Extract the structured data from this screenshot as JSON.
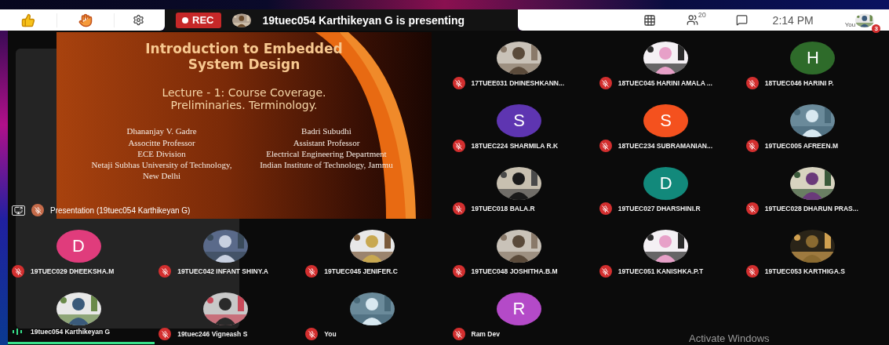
{
  "toolbar": {
    "reactions": [
      {
        "kind": "thumbs"
      },
      {
        "kind": "hand"
      }
    ],
    "record_button": "REC",
    "presenter_text": "19tuec054 Karthikeyan G is presenting",
    "participant_count": "20",
    "time": "2:14 PM",
    "self_label": "You",
    "notification_badge": "3"
  },
  "presentation": {
    "slide": {
      "title": "Introduction to Embedded System Design",
      "subtitle": "Lecture - 1: Course Coverage. Preliminaries. Terminology.",
      "authors": [
        [
          "Dhananjay V. Gadre",
          "Associtte Professor",
          "ECE Division",
          "Netaji Subhas University of Technology, New Delhi"
        ],
        [
          "Badri Subudhi",
          "Assistant Professor",
          "Electrical Engineering Department",
          "Indian Institute of Technology, Jammu"
        ]
      ]
    },
    "label": "Presentation (19tuec054 Karthikeyan G)"
  },
  "participants": [
    {
      "name": "17TUEE031 DHINESHKANN...",
      "muted": true
    },
    {
      "name": "18TUEC045 HARINI AMALA ...",
      "muted": true
    },
    {
      "name": "18TUEC046 HARINI P.",
      "avatar": {
        "kind": "initial",
        "letter": "H",
        "color": "#2e6b2a"
      },
      "muted": true
    },
    {
      "name": "18TUEC224 SHARMILA R.K",
      "avatar": {
        "kind": "initial",
        "letter": "S",
        "color": "#5e35b1"
      },
      "muted": true
    },
    {
      "name": "18TUEC234 SUBRAMANIAN...",
      "avatar": {
        "kind": "initial",
        "letter": "S",
        "color": "#f4511e"
      },
      "muted": true
    },
    {
      "name": "19TUEC005 AFREEN.M",
      "muted": true
    },
    {
      "name": "19TUEC018 BALA.R",
      "muted": true
    },
    {
      "name": "19TUEC027 DHARSHINI.R",
      "avatar": {
        "kind": "initial",
        "letter": "D",
        "color": "#12897b"
      },
      "muted": true
    },
    {
      "name": "19TUEC028 DHARUN PRAS...",
      "muted": true
    },
    {
      "name": "19TUEC029 DHEEKSHA.M",
      "avatar": {
        "kind": "initial",
        "letter": "D",
        "color": "#e03c7c"
      },
      "muted": true
    },
    {
      "name": "19TUEC042 INFANT SHINY.A",
      "muted": true
    },
    {
      "name": "19TUEC045 JENIFER.C",
      "muted": true
    },
    {
      "name": "19TUEC048 JOSHITHA.B.M",
      "muted": true
    },
    {
      "name": "19TUEC051 KANISHKA.P.T",
      "muted": true
    },
    {
      "name": "19TUEC053 KARTHIGA.S",
      "muted": true
    },
    {
      "name": "19tuec054 Karthikeyan G",
      "muted": false
    },
    {
      "name": "19tuec246 Vigneash S",
      "muted": true
    },
    {
      "name": "You",
      "muted": true
    },
    {
      "name": "Ram Dev",
      "avatar": {
        "kind": "initial",
        "letter": "R",
        "color": "#b44ac8"
      },
      "muted": true
    }
  ],
  "os_notice": "Activate Windows"
}
